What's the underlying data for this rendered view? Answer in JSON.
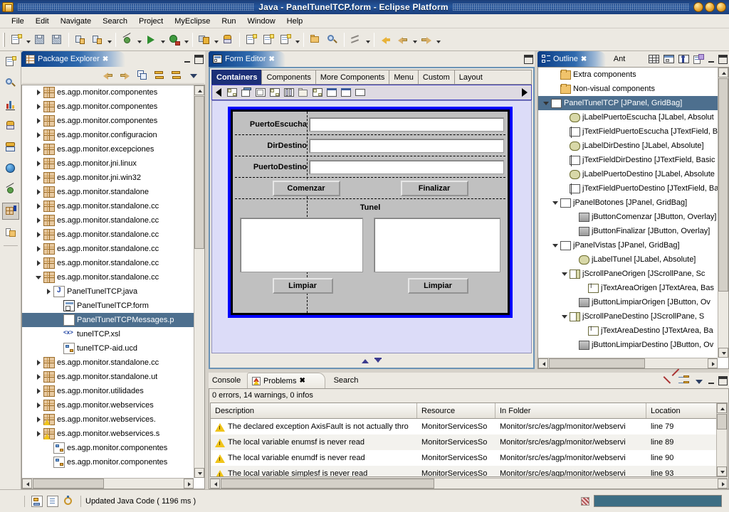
{
  "window": {
    "title": "Java - PanelTunelTCP.form - Eclipse Platform"
  },
  "menubar": {
    "items": [
      "File",
      "Edit",
      "Navigate",
      "Search",
      "Project",
      "MyEclipse",
      "Run",
      "Window",
      "Help"
    ]
  },
  "toolbar": {
    "groups": [
      {
        "buttons": [
          {
            "icon": "new-wizard-icon",
            "dropdown": true
          },
          {
            "icon": "save-icon",
            "dropdown": false
          },
          {
            "icon": "save-all-icon",
            "dropdown": false
          }
        ]
      },
      {
        "buttons": [
          {
            "icon": "build-icon",
            "dropdown": false
          },
          {
            "icon": "run-external-icon",
            "dropdown": true
          }
        ]
      },
      {
        "buttons": [
          {
            "icon": "debug-icon",
            "dropdown": true
          },
          {
            "icon": "run-icon",
            "dropdown": true
          },
          {
            "icon": "run-server-icon",
            "dropdown": true
          }
        ]
      },
      {
        "buttons": [
          {
            "icon": "deploy-icon",
            "dropdown": true
          },
          {
            "icon": "open-db-icon",
            "dropdown": false
          }
        ]
      },
      {
        "buttons": [
          {
            "icon": "new-java-project-icon",
            "dropdown": false
          },
          {
            "icon": "new-package-icon",
            "dropdown": false
          },
          {
            "icon": "new-class-icon",
            "dropdown": true
          }
        ]
      },
      {
        "buttons": [
          {
            "icon": "open-type-icon",
            "dropdown": false
          },
          {
            "icon": "search-icon",
            "dropdown": false
          }
        ]
      },
      {
        "buttons": [
          {
            "icon": "next-annotation-icon",
            "dropdown": true
          }
        ]
      },
      {
        "buttons": [
          {
            "icon": "last-edit-location-icon",
            "dropdown": false
          },
          {
            "icon": "back-icon",
            "dropdown": true
          },
          {
            "icon": "forward-icon",
            "dropdown": true
          }
        ]
      }
    ]
  },
  "fastview": {
    "items": [
      {
        "icon": "new-wizard-icon",
        "selected": false
      },
      {
        "icon": "search-java-icon",
        "selected": false
      },
      {
        "icon": "chart-icon",
        "selected": false
      },
      {
        "icon": "database-explorer-icon",
        "selected": false
      },
      {
        "icon": "cvs-repository-icon",
        "selected": false
      },
      {
        "icon": "myeclipse-icon",
        "selected": false
      },
      {
        "icon": "debug-perspective-icon",
        "selected": false
      },
      {
        "icon": "java-perspective-icon",
        "selected": true
      },
      {
        "icon": "resource-perspective-icon",
        "selected": false
      }
    ]
  },
  "package_explorer": {
    "tab": {
      "label": "Package Explorer",
      "icon": "package-explorer-icon",
      "close": "✖"
    },
    "toolbar": [
      {
        "icon": "back-arrow-icon"
      },
      {
        "icon": "forward-arrow-icon"
      },
      {
        "icon": "collapse-all-icon"
      },
      {
        "icon": "collapse-all-tree-icon"
      },
      {
        "icon": "link-with-editor-icon"
      },
      {
        "icon": "view-menu-icon"
      }
    ],
    "tree": [
      {
        "label": "es.agp.monitor.componentes",
        "icon": "package-icon",
        "twisty": "closed",
        "indent": 1,
        "selected": false
      },
      {
        "label": "es.agp.monitor.componentes",
        "icon": "package-icon",
        "twisty": "closed",
        "indent": 1,
        "selected": false
      },
      {
        "label": "es.agp.monitor.componentes",
        "icon": "package-icon",
        "twisty": "closed",
        "indent": 1,
        "selected": false
      },
      {
        "label": "es.agp.monitor.configuracion",
        "icon": "package-icon",
        "twisty": "closed",
        "indent": 1,
        "selected": false
      },
      {
        "label": "es.agp.monitor.excepciones",
        "icon": "package-icon",
        "twisty": "closed",
        "indent": 1,
        "selected": false
      },
      {
        "label": "es.agp.monitor.jni.linux",
        "icon": "package-icon",
        "twisty": "closed",
        "indent": 1,
        "selected": false
      },
      {
        "label": "es.agp.monitor.jni.win32",
        "icon": "package-icon",
        "twisty": "closed",
        "indent": 1,
        "selected": false
      },
      {
        "label": "es.agp.monitor.standalone",
        "icon": "package-icon",
        "twisty": "closed",
        "indent": 1,
        "selected": false
      },
      {
        "label": "es.agp.monitor.standalone.cc",
        "icon": "package-icon",
        "twisty": "closed",
        "indent": 1,
        "selected": false
      },
      {
        "label": "es.agp.monitor.standalone.cc",
        "icon": "package-icon",
        "twisty": "closed",
        "indent": 1,
        "selected": false
      },
      {
        "label": "es.agp.monitor.standalone.cc",
        "icon": "package-icon",
        "twisty": "closed",
        "indent": 1,
        "selected": false
      },
      {
        "label": "es.agp.monitor.standalone.cc",
        "icon": "package-icon",
        "twisty": "closed",
        "indent": 1,
        "selected": false
      },
      {
        "label": "es.agp.monitor.standalone.cc",
        "icon": "package-icon",
        "twisty": "closed",
        "indent": 1,
        "selected": false
      },
      {
        "label": "es.agp.monitor.standalone.cc",
        "icon": "package-icon",
        "twisty": "open",
        "indent": 1,
        "selected": false
      },
      {
        "label": "PanelTunelTCP.java",
        "icon": "java-file-icon",
        "twisty": "closed",
        "indent": 2,
        "selected": false
      },
      {
        "label": "PanelTunelTCP.form",
        "icon": "form-file-icon",
        "twisty": "none",
        "indent": 3,
        "selected": false
      },
      {
        "label": "PanelTunelTCPMessages.p",
        "icon": "properties-file-icon",
        "twisty": "none",
        "indent": 3,
        "selected": true
      },
      {
        "label": "tunelTCP.xsl",
        "icon": "xsl-file-icon",
        "twisty": "none",
        "indent": 3,
        "selected": false
      },
      {
        "label": "tunelTCP-aid.ucd",
        "icon": "ucd-file-icon",
        "twisty": "none",
        "indent": 3,
        "selected": false
      },
      {
        "label": "es.agp.monitor.standalone.cc",
        "icon": "package-icon",
        "twisty": "closed",
        "indent": 1,
        "selected": false
      },
      {
        "label": "es.agp.monitor.standalone.ut",
        "icon": "package-icon",
        "twisty": "closed",
        "indent": 1,
        "selected": false
      },
      {
        "label": "es.agp.monitor.utilidades",
        "icon": "package-icon",
        "twisty": "closed",
        "indent": 1,
        "selected": false
      },
      {
        "label": "es.agp.monitor.webservices",
        "icon": "package-icon",
        "twisty": "closed",
        "indent": 1,
        "selected": false
      },
      {
        "label": "es.agp.monitor.webservices.",
        "icon": "package-icon-warning",
        "twisty": "closed",
        "indent": 1,
        "selected": false
      },
      {
        "label": "es.agp.monitor.webservices.s",
        "icon": "package-icon-warning",
        "twisty": "closed",
        "indent": 1,
        "selected": false
      },
      {
        "label": "es.agp.monitor.componentes",
        "icon": "ucd-file-icon",
        "twisty": "none",
        "indent": 2,
        "selected": false
      },
      {
        "label": "es.agp.monitor.componentes",
        "icon": "ucd-file-icon",
        "twisty": "none",
        "indent": 2,
        "selected": false
      }
    ]
  },
  "editor": {
    "tab": {
      "label": "Form Editor",
      "icon": "form-editor-icon",
      "close": "✖"
    },
    "palette_tabs": [
      {
        "label": "Containers",
        "selected": true
      },
      {
        "label": "Components",
        "selected": false
      },
      {
        "label": "More Components",
        "selected": false
      },
      {
        "label": "Menu",
        "selected": false
      },
      {
        "label": "Custom",
        "selected": false
      },
      {
        "label": "Layout",
        "selected": false
      }
    ],
    "palette_items": [
      {
        "icon": "jpanel-icon"
      },
      {
        "icon": "jtabbedpane-icon"
      },
      {
        "icon": "jsplitpane-icon"
      },
      {
        "icon": "jscrollpane-icon"
      },
      {
        "icon": "jtoolbar-icon"
      },
      {
        "icon": "jfilechooser-icon"
      },
      {
        "icon": "jdesktoppane-icon"
      },
      {
        "icon": "jinternalframe-icon"
      },
      {
        "icon": "jdialog-icon"
      },
      {
        "icon": "jwindow-icon"
      }
    ],
    "palette_scroll_left": "◀",
    "palette_scroll_right": "▶",
    "form": {
      "rows": [
        {
          "label": "PuertoEscucha",
          "field_value": ""
        },
        {
          "label": "DirDestino",
          "field_value": ""
        },
        {
          "label": "PuertoDestino",
          "field_value": ""
        }
      ],
      "buttons": [
        {
          "label": "Comenzar"
        },
        {
          "label": "Finalizar"
        }
      ],
      "section_title": "Tunel",
      "clear_buttons": [
        {
          "label": "Limpiar"
        },
        {
          "label": "Limpiar"
        }
      ]
    }
  },
  "outline": {
    "tabs": [
      {
        "label": "Outline",
        "icon": "outline-icon",
        "selected": true,
        "close": "✖"
      },
      {
        "label": "Ant",
        "icon": "ant-icon",
        "selected": false
      }
    ],
    "toolbar": [
      {
        "icon": "grid-layout-icon"
      },
      {
        "icon": "preview-icon"
      },
      {
        "icon": "run-form-icon"
      },
      {
        "icon": "properties-icon"
      }
    ],
    "tree": [
      {
        "label": "Extra components",
        "icon": "folder-icon",
        "twisty": "none",
        "indent": 1,
        "selected": false
      },
      {
        "label": "Non-visual components",
        "icon": "folder-icon",
        "twisty": "none",
        "indent": 1,
        "selected": false
      },
      {
        "label": "PanelTunelTCP [JPanel, GridBag]",
        "icon": "panel-icon",
        "twisty": "open",
        "indent": 0,
        "selected": true
      },
      {
        "label": "jLabelPuertoEscucha [JLabel, Absolut",
        "icon": "label-icon",
        "twisty": "none",
        "indent": 2,
        "selected": false
      },
      {
        "label": "jTextFieldPuertoEscucha [JTextField, B",
        "icon": "textfield-icon",
        "twisty": "none",
        "indent": 2,
        "selected": false
      },
      {
        "label": "jLabelDirDestino [JLabel, Absolute]",
        "icon": "label-icon",
        "twisty": "none",
        "indent": 2,
        "selected": false
      },
      {
        "label": "jTextFieldDirDestino [JTextField, Basic",
        "icon": "textfield-icon",
        "twisty": "none",
        "indent": 2,
        "selected": false
      },
      {
        "label": "jLabelPuertoDestino [JLabel, Absolute",
        "icon": "label-icon",
        "twisty": "none",
        "indent": 2,
        "selected": false
      },
      {
        "label": "jTextFieldPuertoDestino [JTextField, Ba",
        "icon": "textfield-icon",
        "twisty": "none",
        "indent": 2,
        "selected": false
      },
      {
        "label": "jPanelBotones [JPanel, GridBag]",
        "icon": "panel-icon",
        "twisty": "open",
        "indent": 1,
        "selected": false
      },
      {
        "label": "jButtonComenzar [JButton, Overlay]",
        "icon": "button-icon",
        "twisty": "none",
        "indent": 3,
        "selected": false
      },
      {
        "label": "jButtonFinalizar [JButton, Overlay]",
        "icon": "button-icon",
        "twisty": "none",
        "indent": 3,
        "selected": false
      },
      {
        "label": "jPanelVistas [JPanel, GridBag]",
        "icon": "panel-icon",
        "twisty": "open",
        "indent": 1,
        "selected": false
      },
      {
        "label": "jLabelTunel [JLabel, Absolute]",
        "icon": "label-icon",
        "twisty": "none",
        "indent": 3,
        "selected": false
      },
      {
        "label": "jScrollPaneOrigen [JScrollPane, Sc",
        "icon": "scrollpane-icon",
        "twisty": "open",
        "indent": 2,
        "selected": false
      },
      {
        "label": "jTextAreaOrigen [JTextArea, Bas",
        "icon": "textarea-icon",
        "twisty": "none",
        "indent": 4,
        "selected": false
      },
      {
        "label": "jButtonLimpiarOrigen [JButton, Ov",
        "icon": "button-icon",
        "twisty": "none",
        "indent": 3,
        "selected": false
      },
      {
        "label": "jScrollPaneDestino [JScrollPane, S",
        "icon": "scrollpane-icon",
        "twisty": "open",
        "indent": 2,
        "selected": false
      },
      {
        "label": "jTextAreaDestino [JTextArea, Ba",
        "icon": "textarea-icon",
        "twisty": "none",
        "indent": 4,
        "selected": false
      },
      {
        "label": "jButtonLimpiarDestino [JButton, Ov",
        "icon": "button-icon",
        "twisty": "none",
        "indent": 3,
        "selected": false
      }
    ]
  },
  "problems": {
    "tabs": [
      {
        "label": "Console",
        "selected": false
      },
      {
        "label": "Problems",
        "selected": true,
        "icon": "problems-icon",
        "close": "✖"
      },
      {
        "label": "Search",
        "selected": false
      }
    ],
    "toolbar": [
      {
        "icon": "delete-icon"
      },
      {
        "icon": "filter-icon"
      },
      {
        "icon": "view-menu-icon"
      }
    ],
    "summary": "0 errors, 14 warnings, 0 infos",
    "columns": [
      "Description",
      "Resource",
      "In Folder",
      "Location"
    ],
    "rows": [
      {
        "severity": "warning",
        "description": "The declared exception AxisFault is not actually thro",
        "resource": "MonitorServicesSo",
        "in_folder": "Monitor/src/es/agp/monitor/webservi",
        "location": "line 79"
      },
      {
        "severity": "warning",
        "description": "The local variable enumsf is never read",
        "resource": "MonitorServicesSo",
        "in_folder": "Monitor/src/es/agp/monitor/webservi",
        "location": "line 89"
      },
      {
        "severity": "warning",
        "description": "The local variable enumdf is never read",
        "resource": "MonitorServicesSo",
        "in_folder": "Monitor/src/es/agp/monitor/webservi",
        "location": "line 90"
      },
      {
        "severity": "warning",
        "description": "The local variable simplesf is never read",
        "resource": "MonitorServicesSo",
        "in_folder": "Monitor/src/es/agp/monitor/webservi",
        "location": "line 93"
      }
    ]
  },
  "statusbar": {
    "icons": [
      {
        "icon": "writable-icon"
      },
      {
        "icon": "insert-mode-icon"
      },
      {
        "icon": "build-status-icon"
      }
    ],
    "message": "Updated Java Code ( 1196 ms )"
  },
  "colors": {
    "title_bar": "#1f4a8c",
    "accent_blue": "#0a3d86",
    "selection": "#4d6f8e",
    "panel_bg": "#ece9e2",
    "canvas_bg": "#dcdcf8",
    "warning": "#f0c419",
    "palette_selected": "#1b2f77"
  }
}
